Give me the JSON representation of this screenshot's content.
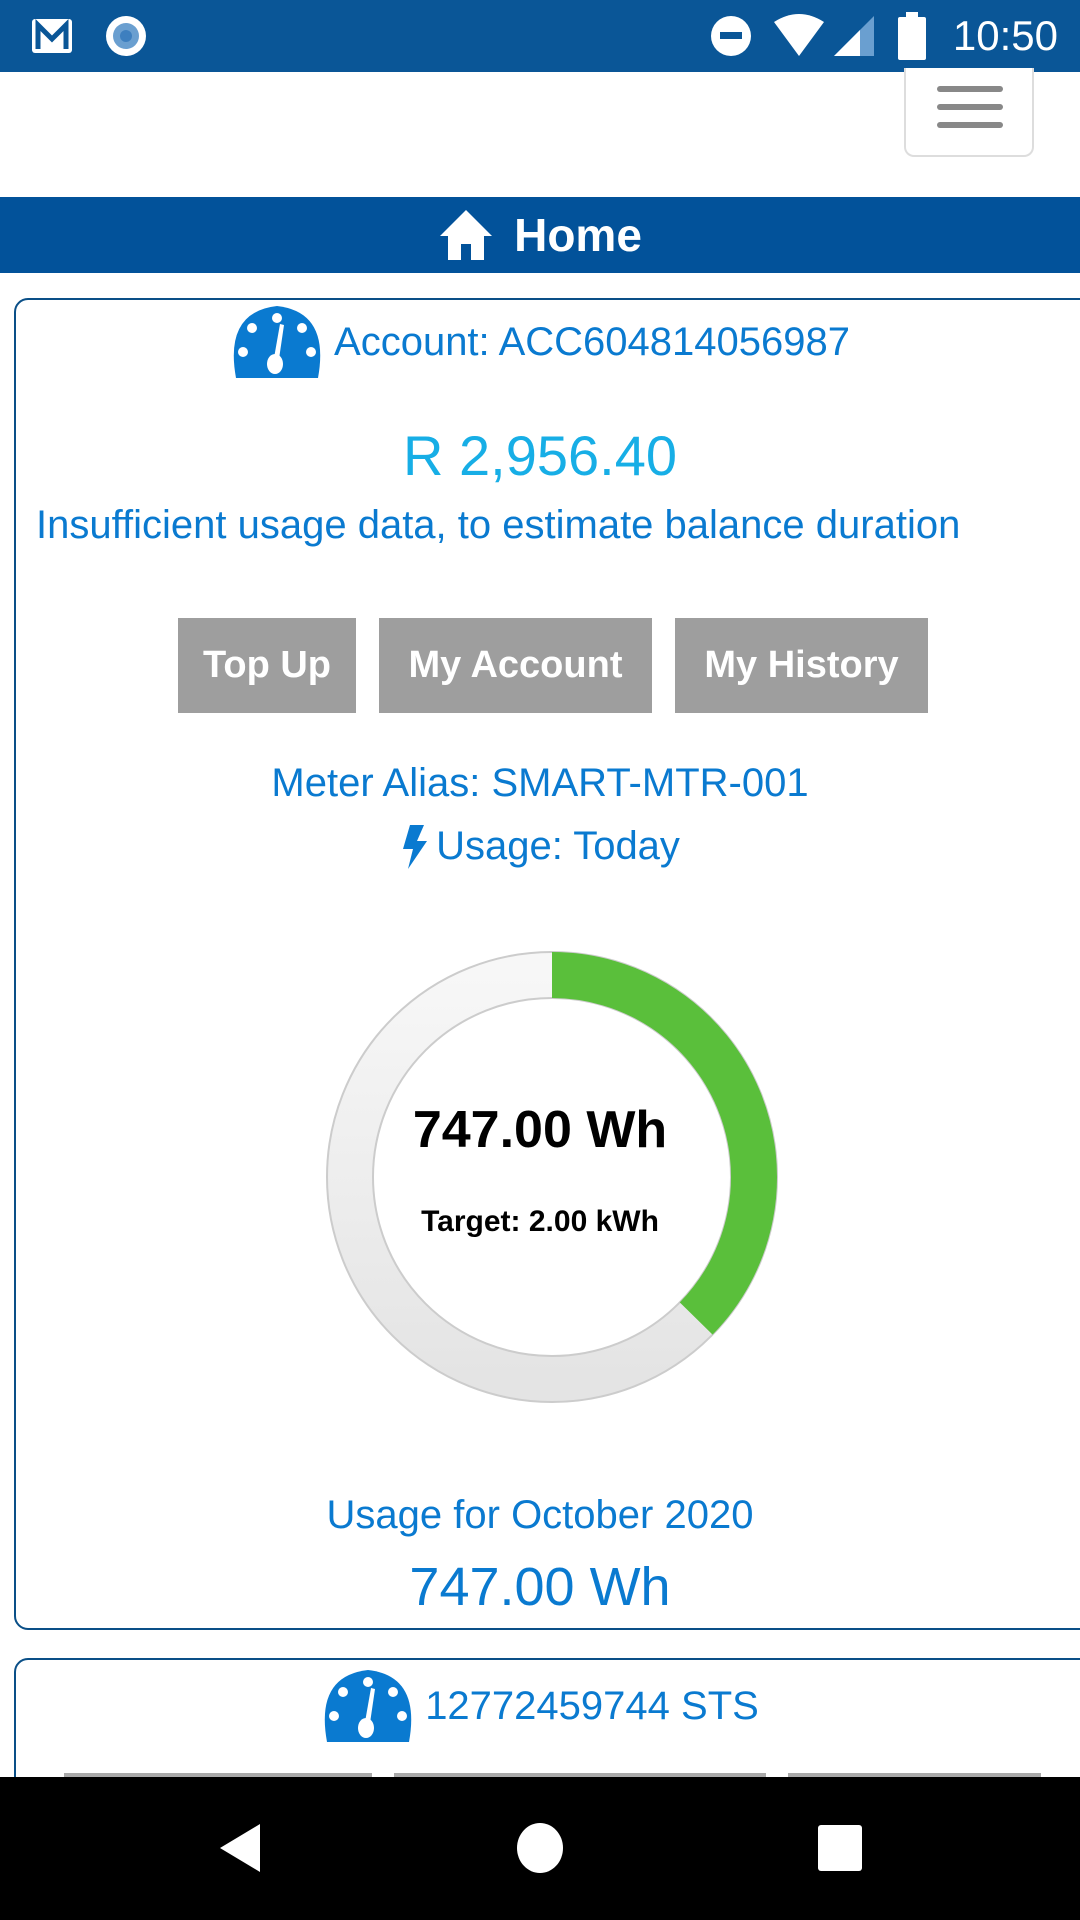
{
  "status_bar": {
    "time": "10:50",
    "icons": [
      "gmail-icon",
      "record-icon",
      "dnd-icon",
      "wifi-icon",
      "signal-icon",
      "battery-icon"
    ]
  },
  "header": {
    "menu_icon": "hamburger-icon",
    "title": "Home",
    "title_icon": "home-icon"
  },
  "account_card": {
    "account_label": "Account: ACC604814056987",
    "balance": "R 2,956.40",
    "balance_note": "Insufficient usage data, to estimate balance duration",
    "buttons": [
      "Top Up",
      "My Account",
      "My History"
    ],
    "meter_alias": "Meter Alias: SMART-MTR-001",
    "usage_label": "Usage: Today",
    "gauge": {
      "value": "747.00 Wh",
      "target": "Target: 2.00 kWh",
      "progress_fraction": 0.3735,
      "fill_color": "#5abf3b",
      "track_color": "#ececec"
    },
    "month_label": "Usage for October 2020",
    "month_value": "747.00 Wh"
  },
  "meter_card": {
    "label": "12772459744 STS"
  },
  "colors": {
    "primary": "#02529a",
    "accent_text": "#0a7ad0",
    "balance": "#17aee6",
    "button": "#9e9e9e"
  }
}
